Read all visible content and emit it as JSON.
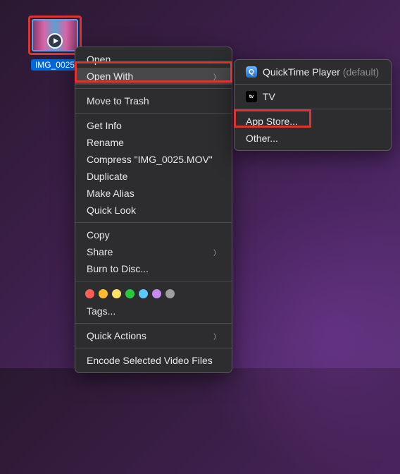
{
  "file": {
    "name": "IMG_0025"
  },
  "menu": {
    "open": "Open",
    "open_with": "Open With",
    "move_to_trash": "Move to Trash",
    "get_info": "Get Info",
    "rename": "Rename",
    "compress": "Compress \"IMG_0025.MOV\"",
    "duplicate": "Duplicate",
    "make_alias": "Make Alias",
    "quick_look": "Quick Look",
    "copy": "Copy",
    "share": "Share",
    "burn": "Burn to Disc...",
    "tags": "Tags...",
    "quick_actions": "Quick Actions",
    "encode": "Encode Selected Video Files"
  },
  "submenu": {
    "quicktime": "QuickTime Player",
    "default_suffix": "(default)",
    "tv": "TV",
    "app_store": "App Store...",
    "other": "Other..."
  },
  "tag_colors": [
    "#ff5f57",
    "#ffbd2e",
    "#ffe264",
    "#28c840",
    "#5ac8fa",
    "#c78bf0",
    "#9f9f9f"
  ]
}
